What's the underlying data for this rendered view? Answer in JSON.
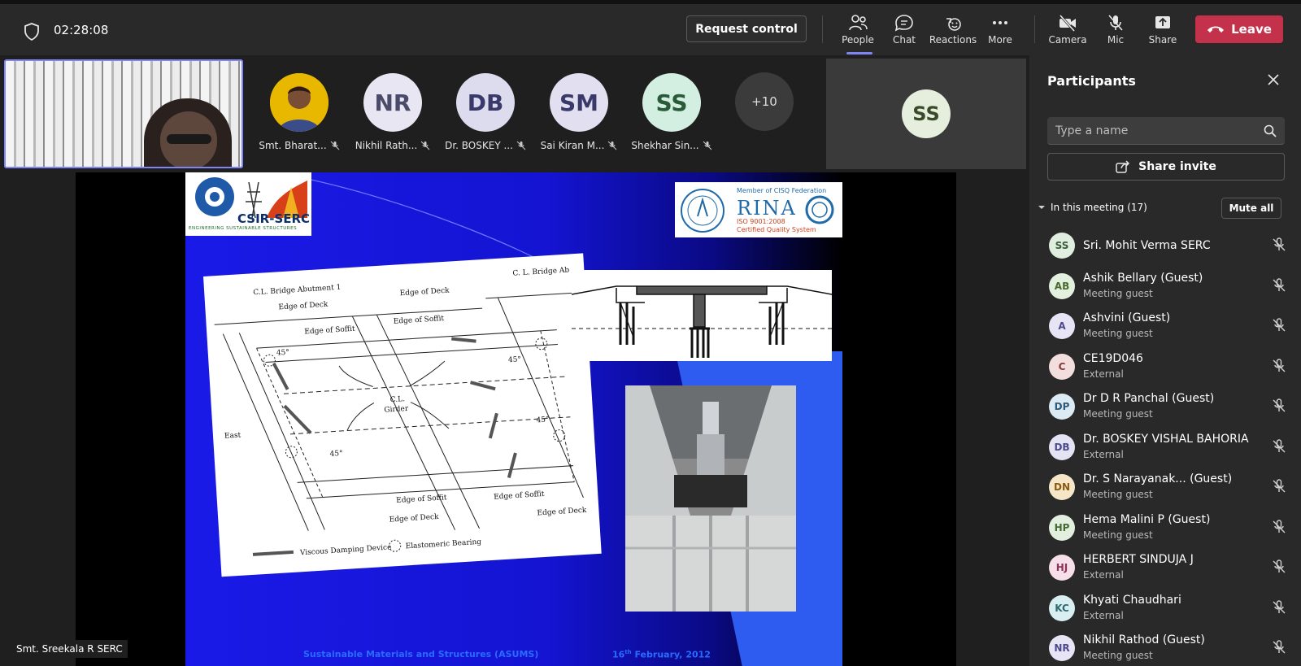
{
  "header": {
    "timer": "02:28:08",
    "request_control": "Request control",
    "buttons": {
      "people": "People",
      "chat": "Chat",
      "reactions": "Reactions",
      "more": "More",
      "camera": "Camera",
      "mic": "Mic",
      "share": "Share"
    },
    "leave": "Leave"
  },
  "gallery": {
    "tiles": [
      {
        "initials": "",
        "name": "Smt. Bharat...",
        "color": "#f0c000"
      },
      {
        "initials": "NR",
        "name": "Nikhil Rath...",
        "color": "#e8e6f2"
      },
      {
        "initials": "DB",
        "name": "Dr. BOSKEY ...",
        "color": "#dcdcee"
      },
      {
        "initials": "SM",
        "name": "Sai Kiran M...",
        "color": "#e1dff0"
      },
      {
        "initials": "SS",
        "name": "Shekhar Sin...",
        "color": "#d3efe1"
      }
    ],
    "overflow": "+10",
    "screen_tile_initials": "SS"
  },
  "slide": {
    "footer_left": "Sustainable Materials and Structures (ASUMS)",
    "footer_date": "16",
    "footer_sup": "th",
    "footer_month": " February, 2012",
    "logo1_text": "CSIR-SERC",
    "logo1_sub": "ENGINEERING SUSTAINABLE STRUCTURES",
    "logo2_member": "Member of CISQ Federation",
    "logo2_name": "RINA",
    "logo2_iso": "ISO 9001:2008",
    "logo2_cert": "Certified Quality System",
    "diagram_labels": {
      "abut1": "C.L. Bridge Abutment 1",
      "abut2": "C. L. Bridge Ab",
      "edge_deck": "Edge of Deck",
      "edge_soffit": "Edge of Soffit",
      "girder1": "C.L.",
      "girder2": "Girder",
      "east": "East",
      "angle": "45°",
      "legend1": "Viscous Damping Device",
      "legend2": "Elastomeric Bearing"
    }
  },
  "presenter_name": "Smt. Sreekala R SERC",
  "panel": {
    "title": "Participants",
    "search_placeholder": "Type a name",
    "share_invite": "Share invite",
    "in_meeting": "In this meeting (17)",
    "mute_all": "Mute all",
    "participants": [
      {
        "initials": "SS",
        "name": "Sri. Mohit Verma SERC",
        "guest": "",
        "sub": "",
        "bg": "#dfeede",
        "fg": "#3a5a3a"
      },
      {
        "initials": "AB",
        "name": "Ashik Bellary",
        "guest": "(Guest)",
        "sub": "Meeting guest",
        "bg": "#e3f0dd",
        "fg": "#4a6a30"
      },
      {
        "initials": "A",
        "name": "Ashvini",
        "guest": "(Guest)",
        "sub": "Meeting guest",
        "bg": "#e6e4f5",
        "fg": "#4c4a8c"
      },
      {
        "initials": "C",
        "name": "CE19D046",
        "guest": "",
        "sub": "External",
        "bg": "#f3dede",
        "fg": "#8a3a3a"
      },
      {
        "initials": "DP",
        "name": "Dr D R Panchal",
        "guest": "(Guest)",
        "sub": "Meeting guest",
        "bg": "#dceaf3",
        "fg": "#2e5a7a"
      },
      {
        "initials": "DB",
        "name": "Dr. BOSKEY VISHAL BAHORIA",
        "guest": "",
        "sub": "External",
        "bg": "#e4e3f4",
        "fg": "#4a4a8a"
      },
      {
        "initials": "DN",
        "name": "Dr. S Narayanak...",
        "guest": "(Guest)",
        "sub": "Meeting guest",
        "bg": "#f6e6c8",
        "fg": "#8a5a10"
      },
      {
        "initials": "HP",
        "name": "Hema Malini P",
        "guest": "(Guest)",
        "sub": "Meeting guest",
        "bg": "#e2eede",
        "fg": "#446a34"
      },
      {
        "initials": "HJ",
        "name": "HERBERT SINDUJA J",
        "guest": "",
        "sub": "External",
        "bg": "#f6dfe8",
        "fg": "#8a3458"
      },
      {
        "initials": "KC",
        "name": "Khyati Chaudhari",
        "guest": "",
        "sub": "External",
        "bg": "#d9eef0",
        "fg": "#2e6a70"
      },
      {
        "initials": "NR",
        "name": "Nikhil Rathod",
        "guest": "(Guest)",
        "sub": "Meeting guest",
        "bg": "#e6e4f5",
        "fg": "#4c4a8c"
      }
    ]
  },
  "colors": {
    "accent": "#7f85f5",
    "leave": "#c4314b",
    "background": "#1f1f1f",
    "panel": "#292929"
  }
}
